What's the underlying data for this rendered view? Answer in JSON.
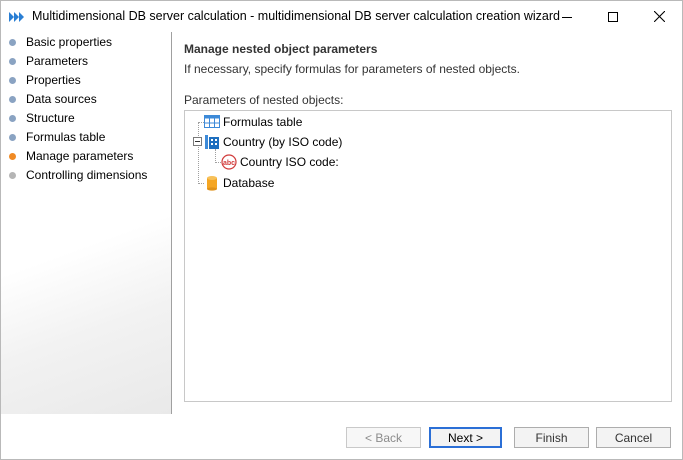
{
  "window": {
    "title": "Multidimensional DB server calculation - multidimensional DB server calculation creation wizard"
  },
  "sidebar": {
    "items": [
      {
        "label": "Basic properties",
        "state": "normal"
      },
      {
        "label": "Parameters",
        "state": "normal"
      },
      {
        "label": "Properties",
        "state": "normal"
      },
      {
        "label": "Data sources",
        "state": "normal"
      },
      {
        "label": "Structure",
        "state": "normal"
      },
      {
        "label": "Formulas table",
        "state": "normal"
      },
      {
        "label": "Manage parameters",
        "state": "active"
      },
      {
        "label": "Controlling dimensions",
        "state": "disabled"
      }
    ]
  },
  "main": {
    "heading": "Manage nested object parameters",
    "subtitle": "If necessary, specify formulas for parameters of nested objects.",
    "tree_label": "Parameters of nested objects:",
    "tree": [
      {
        "label": "Formulas table",
        "icon": "table-icon"
      },
      {
        "label": "Country (by ISO code)",
        "icon": "dictionary-icon",
        "expanded": true
      },
      {
        "label": "Country ISO code:",
        "icon": "text-param-icon"
      },
      {
        "label": "Database",
        "icon": "database-icon"
      }
    ]
  },
  "footer": {
    "back_label": "< Back",
    "next_label": "Next >",
    "finish_label": "Finish",
    "cancel_label": "Cancel"
  },
  "colors": {
    "accent_active": "#f08a24",
    "nav_dot": "#8aa3c2",
    "default_button_border": "#2b6fd6"
  }
}
